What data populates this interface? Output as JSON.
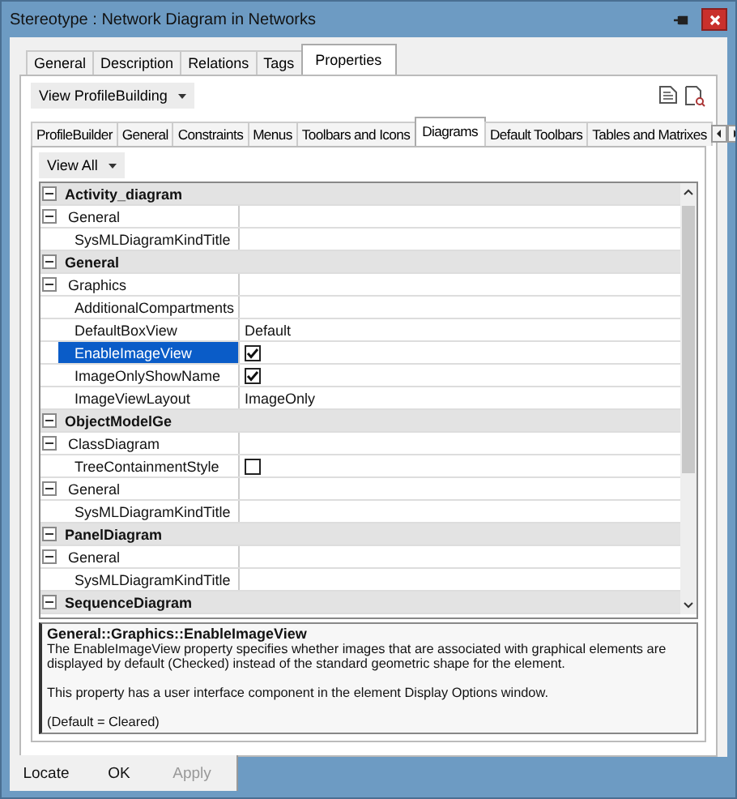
{
  "window": {
    "title": "Stereotype : Network Diagram in Networks"
  },
  "tabs": [
    {
      "label": "General",
      "selected": false
    },
    {
      "label": "Description",
      "selected": false
    },
    {
      "label": "Relations",
      "selected": false
    },
    {
      "label": "Tags",
      "selected": false
    },
    {
      "label": "Properties",
      "selected": true
    }
  ],
  "profile_dropdown": {
    "value": "View ProfileBuilding"
  },
  "inner_tabs": [
    {
      "label": "ProfileBuilder",
      "selected": false
    },
    {
      "label": "General",
      "selected": false
    },
    {
      "label": "Constraints",
      "selected": false
    },
    {
      "label": "Menus",
      "selected": false
    },
    {
      "label": "Toolbars and Icons",
      "selected": false
    },
    {
      "label": "Diagrams",
      "selected": true
    },
    {
      "label": "Default Toolbars",
      "selected": false
    },
    {
      "label": "Tables and Matrixes",
      "selected": false
    }
  ],
  "view_dropdown": {
    "value": "View All"
  },
  "grid": {
    "categories": [
      {
        "label": "Activity_diagram",
        "expanded": true,
        "children": [
          {
            "label": "General",
            "expanded": true,
            "children": [
              {
                "kind": "text",
                "name": "SysMLDiagramKindTitle",
                "selected": false
              }
            ]
          }
        ]
      },
      {
        "label": "General",
        "expanded": true,
        "children": [
          {
            "label": "Graphics",
            "expanded": true,
            "children": [
              {
                "kind": "text",
                "name": "AdditionalCompartments",
                "selected": false
              },
              {
                "kind": "text",
                "name": "DefaultBoxView",
                "value": "Default",
                "selected": false
              },
              {
                "kind": "checkbox",
                "name": "EnableImageView",
                "checked": true,
                "selected": true
              },
              {
                "kind": "checkbox",
                "name": "ImageOnlyShowName",
                "checked": true,
                "selected": false
              },
              {
                "kind": "text",
                "name": "ImageViewLayout",
                "value": "ImageOnly",
                "selected": false
              }
            ]
          }
        ]
      },
      {
        "label": "ObjectModelGe",
        "expanded": true,
        "children": [
          {
            "label": "ClassDiagram",
            "expanded": true,
            "children": [
              {
                "kind": "checkbox",
                "name": "TreeContainmentStyle",
                "checked": false,
                "selected": false
              }
            ]
          },
          {
            "label": "General",
            "expanded": true,
            "children": [
              {
                "kind": "text",
                "name": "SysMLDiagramKindTitle",
                "selected": false
              }
            ]
          }
        ]
      },
      {
        "label": "PanelDiagram",
        "expanded": true,
        "children": [
          {
            "label": "General",
            "expanded": true,
            "children": [
              {
                "kind": "text",
                "name": "SysMLDiagramKindTitle",
                "selected": false
              }
            ]
          }
        ]
      },
      {
        "label": "SequenceDiagram",
        "expanded": true
      }
    ]
  },
  "description": {
    "title": "General::Graphics::EnableImageView",
    "paragraphs": [
      "The EnableImageView property specifies whether images that are associated with graphical elements are displayed by default (Checked) instead of the standard geometric shape for the element.",
      "This property has a user interface component in the element Display Options window.",
      "(Default = Cleared)"
    ]
  },
  "buttons": [
    {
      "label": "Locate",
      "disabled": false
    },
    {
      "label": "OK",
      "disabled": false
    },
    {
      "label": "Apply",
      "disabled": true
    }
  ]
}
